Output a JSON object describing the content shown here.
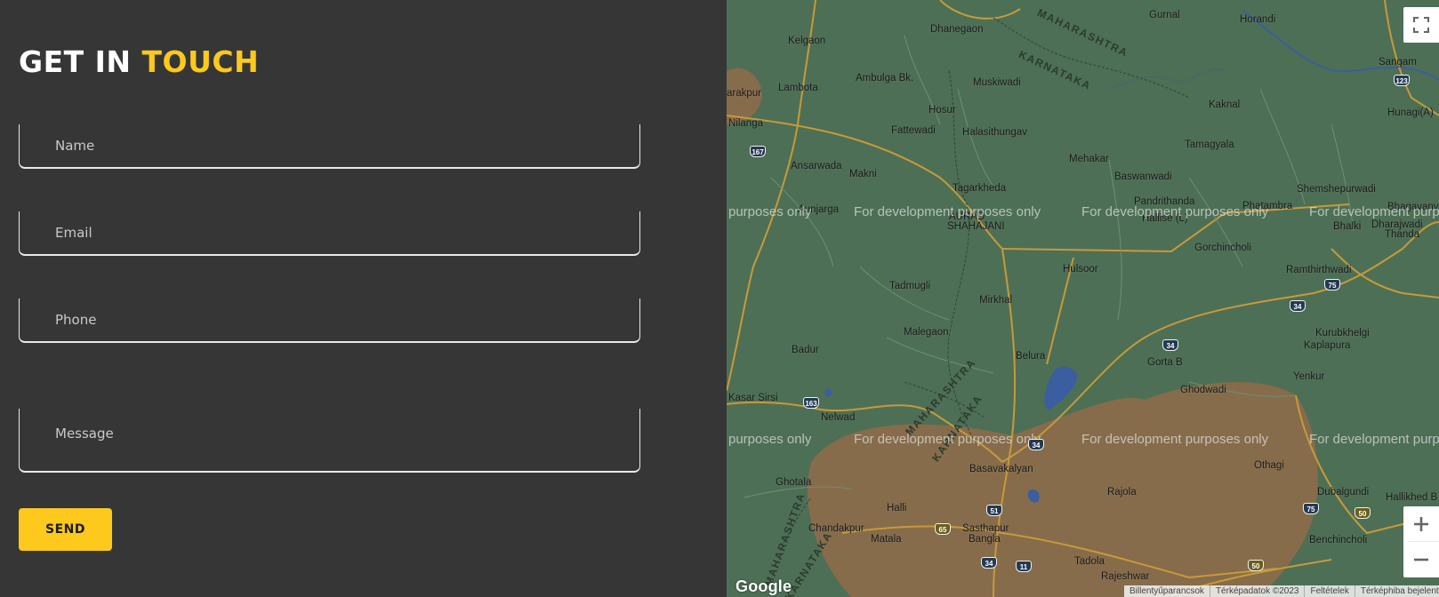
{
  "form": {
    "title_part1": "GET IN",
    "title_part2": "TOUCH",
    "fields": {
      "name_placeholder": "Name",
      "email_placeholder": "Email",
      "phone_placeholder": "Phone",
      "message_placeholder": "Message"
    },
    "send_label": "SEND"
  },
  "map": {
    "watermark": "For development purposes only",
    "watermark_partial": "purposes only",
    "places": {
      "gurnal": "Gurnal",
      "horandi": "Horandi",
      "kelgaon": "Kelgaon",
      "dhanegaon": "Dhanegaon",
      "sangam": "Sangam",
      "lambota": "Lambota",
      "ambulga": "Ambulga Bk.",
      "muskiwadi": "Muskiwadi",
      "hunagi": "Hunagi(A)",
      "rakpur": "arakpur",
      "nilanga": "Nilanga",
      "hosur": "Hosur",
      "kaknal": "Kaknal",
      "fattewadi": "Fattewadi",
      "halasithungav": "Halasithungav",
      "tamagyala": "Tamagyala",
      "mehakar": "Mehakar",
      "ansarwada": "Ansarwada",
      "makni": "Makni",
      "baswanwadi": "Baswanwadi",
      "bhagavanv": "Bhagavanv",
      "shemshepurwadi": "Shemshepurwadi",
      "tagarkheda": "Tagarkheda",
      "pandrithanda": "Pandrithanda",
      "phatambra": "Phatambra",
      "aunjarga": "Aunjarga",
      "aurad": "AURAD",
      "shahajani": "SHAHAJANI",
      "hallise": "Hallise (L)",
      "bhalki": "Bhalki",
      "dharajwadi": "Dharajwadi",
      "thanda": "Thanda",
      "gorchincholi": "Gorchincholi",
      "hulsoor": "Hulsoor",
      "ramthirthwadi": "Ramthirthwadi",
      "tadmugli": "Tadmugli",
      "mirkhal": "Mirkhal",
      "kurubkhelgi": "Kurubkhelgi",
      "malegaon": "Malegaon",
      "kaplapura": "Kaplapura",
      "badur": "Badur",
      "belura": "Belura",
      "gorta": "Gorta B",
      "yenkur": "Yenkur",
      "kasarsirsi": "Kasar Sirsi",
      "ghodwadi": "Ghodwadi",
      "nelwad": "Nelwad",
      "basavakalyan": "Basavakalyan",
      "othagi": "Othagi",
      "ghotala": "Ghotala",
      "rajola": "Rajola",
      "dubalgundi": "Dubalgundi",
      "hallikhed": "Hallikhed B",
      "halli": "Halli",
      "chandakpur": "Chandakpur",
      "sasthapur": "Sasthapur",
      "bangla": "Bangla",
      "matala": "Matala",
      "benchincholi": "Benchincholi",
      "tadola": "Tadola",
      "rajeshwar": "Rajeshwar"
    },
    "states": {
      "maharashtra": "MAHARASHTRA",
      "karnataka": "KARNATAKA"
    },
    "roads": [
      "167",
      "123",
      "75",
      "34",
      "34",
      "163",
      "34",
      "51",
      "65",
      "34",
      "11",
      "75",
      "50",
      "50"
    ],
    "google": "Google",
    "attribution": [
      "Billentyűparancsok",
      "Térképadatok ©2023",
      "Feltételek",
      "Térképhiba bejelentése"
    ],
    "colors": {
      "land": "#4d6f55",
      "urban": "#866c4b",
      "water": "#3a5ea0",
      "road": "#c79a3a"
    }
  }
}
